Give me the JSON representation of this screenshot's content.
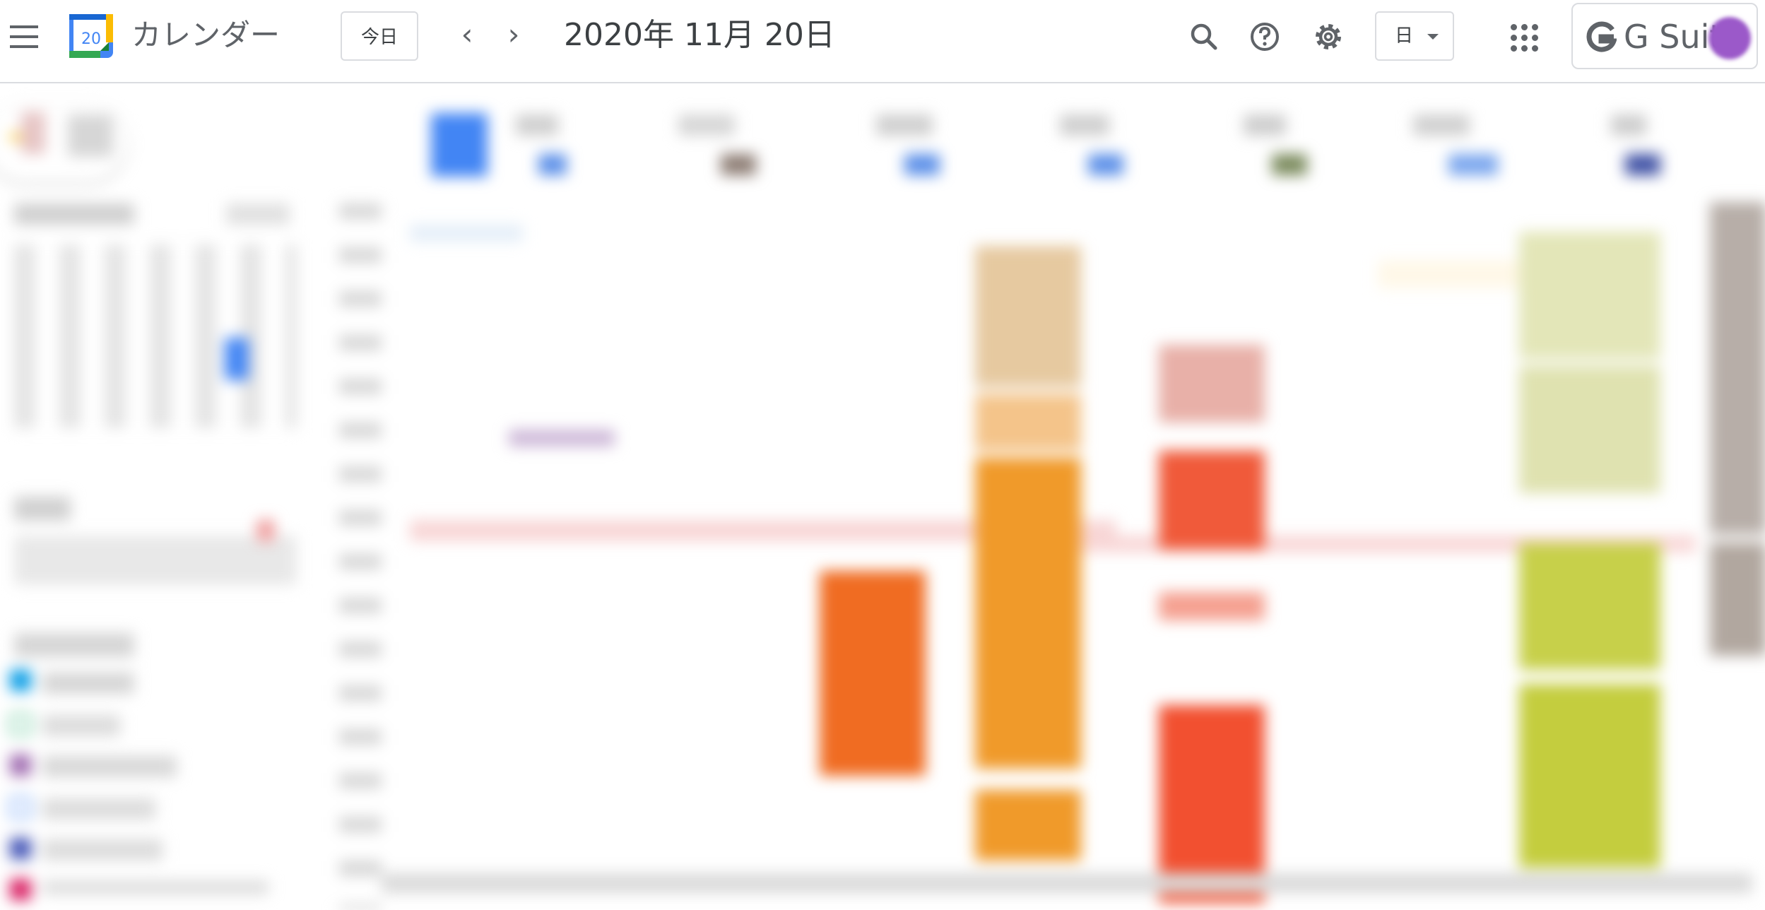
{
  "header": {
    "app_title": "カレンダー",
    "logo_day": "20",
    "today_label": "今日",
    "prev_label": "‹",
    "next_label": "›",
    "date_title": "2020年 11月 20日",
    "view_label": "日",
    "brand_label": "G Suite"
  },
  "icons": [
    "menu-icon",
    "search-icon",
    "help-icon",
    "settings-icon",
    "apps-grid-icon",
    "dropdown-caret-icon"
  ],
  "colors": {
    "accent_blue": "#4285f4",
    "event_orange": "#f09300",
    "event_tangerine": "#f4511e",
    "event_red": "#e53935",
    "event_pistachio": "#c0ca33",
    "event_flamingo": "#e67c73",
    "event_lavender": "#b39ddb",
    "event_beige": "#e6c9a0",
    "now_line": "#f8c5c5"
  }
}
